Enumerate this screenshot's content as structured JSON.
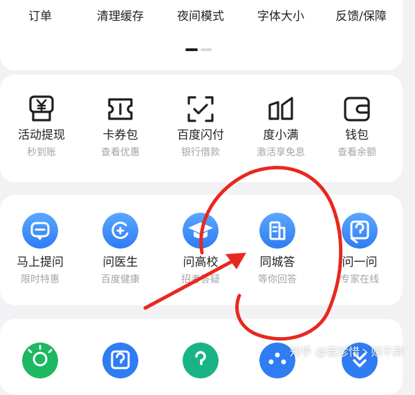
{
  "row1": [
    {
      "label": "订单"
    },
    {
      "label": "清理缓存"
    },
    {
      "label": "夜间模式"
    },
    {
      "label": "字体大小"
    },
    {
      "label": "反馈/保障"
    }
  ],
  "row2": [
    {
      "label": "活动提现",
      "sub": "秒到账",
      "icon": "yuan-receipt-icon"
    },
    {
      "label": "卡券包",
      "sub": "查看优惠",
      "icon": "coupon-ticket-icon"
    },
    {
      "label": "百度闪付",
      "sub": "银行借款",
      "icon": "scan-check-icon"
    },
    {
      "label": "度小满",
      "sub": "激活享免息",
      "icon": "duxiaoman-logo-icon"
    },
    {
      "label": "钱包",
      "sub": "查看余额",
      "icon": "wallet-icon"
    }
  ],
  "row3": [
    {
      "label": "马上提问",
      "sub": "限时特惠",
      "icon": "chat-bubble-icon"
    },
    {
      "label": "问医生",
      "sub": "百度健康",
      "icon": "medical-cross-icon"
    },
    {
      "label": "问高校",
      "sub": "招考答疑",
      "icon": "graduation-cap-icon"
    },
    {
      "label": "同城答",
      "sub": "等你回答",
      "icon": "building-icon"
    },
    {
      "label": "问一问",
      "sub": "专家在线",
      "icon": "question-card-icon"
    }
  ],
  "row4": [
    {
      "icon": "lightbulb-icon",
      "color": "#1db862"
    },
    {
      "icon": "question-card-icon",
      "color": "#2f7cf3"
    },
    {
      "icon": "question-mark-icon",
      "color": "#19b486"
    },
    {
      "icon": "network-icon",
      "color": "#2f7cf3"
    },
    {
      "icon": "diamond-logo-icon",
      "color": "#2f7cf3"
    }
  ],
  "watermark": "知乎 @若珍惜丶则不弃",
  "annotation_color": "#e8281f"
}
